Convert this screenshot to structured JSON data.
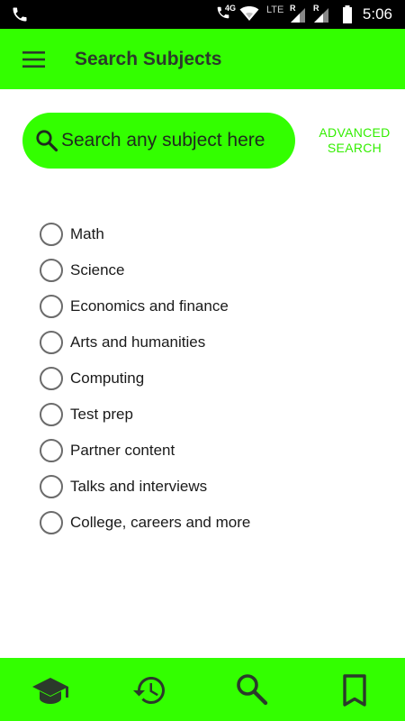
{
  "status_bar": {
    "network": "4G",
    "lte": "LTE",
    "roaming_1": "R",
    "roaming_2": "R",
    "time": "5:06",
    "icons": [
      "phone-call-icon",
      "wifi-icon",
      "signal-icon",
      "battery-icon"
    ]
  },
  "app_bar": {
    "title": "Search Subjects",
    "menu_icon": "hamburger-menu-icon"
  },
  "search": {
    "placeholder": "Search any subject here",
    "icon": "search-icon",
    "advanced_line1": "ADVANCED",
    "advanced_line2": "SEARCH"
  },
  "subjects": [
    {
      "label": "Math",
      "selected": false
    },
    {
      "label": "Science",
      "selected": false
    },
    {
      "label": "Economics and finance",
      "selected": false
    },
    {
      "label": "Arts and humanities",
      "selected": false
    },
    {
      "label": "Computing",
      "selected": false
    },
    {
      "label": "Test prep",
      "selected": false
    },
    {
      "label": "Partner content",
      "selected": false
    },
    {
      "label": "Talks and interviews",
      "selected": false
    },
    {
      "label": "College, careers and more",
      "selected": false
    }
  ],
  "bottom_nav": {
    "items": [
      "graduation-cap-icon",
      "history-icon",
      "search-icon",
      "bookmark-icon"
    ]
  },
  "colors": {
    "accent": "#33ff00",
    "advanced_text": "#33ee00",
    "title_text": "#2b3a2b",
    "status_bar": "#000000"
  }
}
